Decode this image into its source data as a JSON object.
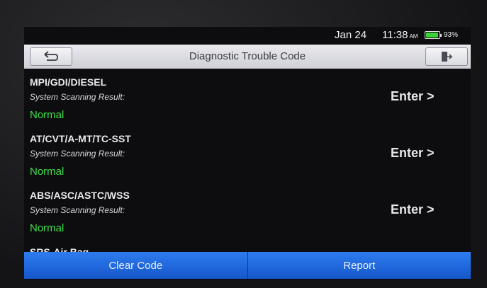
{
  "status": {
    "date": "Jan 24",
    "time": "11:38",
    "ampm": "AM",
    "battery_percent": "93%",
    "battery_level": 0.93
  },
  "header": {
    "title": "Diagnostic Trouble Code",
    "back_icon": "back-arrow-icon",
    "exit_icon": "exit-icon"
  },
  "systems": [
    {
      "name": "MPI/GDI/DIESEL",
      "subtitle": "System Scanning Result:",
      "result": "Normal",
      "action": "Enter >"
    },
    {
      "name": "AT/CVT/A-MT/TC-SST",
      "subtitle": "System Scanning Result:",
      "result": "Normal",
      "action": "Enter >"
    },
    {
      "name": "ABS/ASC/ASTC/WSS",
      "subtitle": "System Scanning Result:",
      "result": "Normal",
      "action": "Enter >"
    },
    {
      "name": "SRS-Air Bag"
    }
  ],
  "footer": {
    "clear_label": "Clear Code",
    "report_label": "Report"
  },
  "colors": {
    "result_normal": "#3fe04a",
    "footer_bar": "#1f6be0",
    "header_bar": "#dcdde2"
  }
}
